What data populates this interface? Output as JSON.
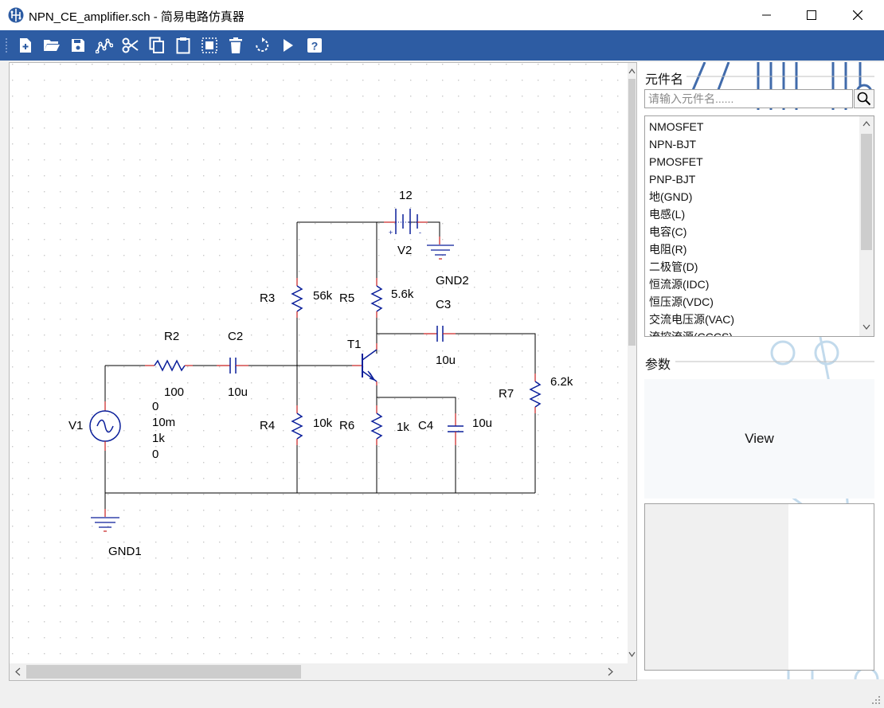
{
  "window": {
    "title": "NPN_CE_amplifier.sch - 简易电路仿真器",
    "minimize": "—",
    "maximize": "☐",
    "close": "✕"
  },
  "toolbar": {
    "buttons": [
      "new-file-icon",
      "open-folder-icon",
      "save-icon",
      "wire-icon",
      "cut-icon",
      "copy-icon",
      "paste-icon",
      "select-all-icon",
      "delete-icon",
      "rotate-icon",
      "run-icon",
      "help-icon"
    ]
  },
  "schematic": {
    "labels": {
      "v2_value": "12",
      "v2_name": "V2",
      "gnd2": "GND2",
      "r3_name": "R3",
      "r3_value": "56k",
      "r5_name": "R5",
      "r5_value": "5.6k",
      "c3_name": "C3",
      "c3_value": "10u",
      "t1_name": "T1",
      "r2_name": "R2",
      "r2_value": "100",
      "c2_name": "C2",
      "c2_value": "10u",
      "r7_name": "R7",
      "r7_value": "6.2k",
      "v1_name": "V1",
      "v1_p1": "0",
      "v1_p2": "10m",
      "v1_p3": "1k",
      "v1_p4": "0",
      "r4_name": "R4",
      "r4_value": "10k",
      "r6_name": "R6",
      "r6_value": "1k",
      "c4_name": "C4",
      "c4_value": "10u",
      "gnd1": "GND1",
      "bat_plus": "+",
      "bat_minus": "-"
    },
    "colors": {
      "wire": "#000000",
      "component": "#0a1e9a",
      "pin": "#c81e1e",
      "grid": "#c8c8c8"
    }
  },
  "sidebar": {
    "component_name_label": "元件名",
    "search_placeholder": "请输入元件名......",
    "components": [
      "NMOSFET",
      "NPN-BJT",
      "PMOSFET",
      "PNP-BJT",
      "地(GND)",
      "电感(L)",
      "电容(C)",
      "电阻(R)",
      "二极管(D)",
      "恒流源(IDC)",
      "恒压源(VDC)",
      "交流电压源(VAC)",
      "流控流源(CCCS)"
    ],
    "params_label": "参数",
    "view_label": "View"
  },
  "accent": "#2d5ca3"
}
